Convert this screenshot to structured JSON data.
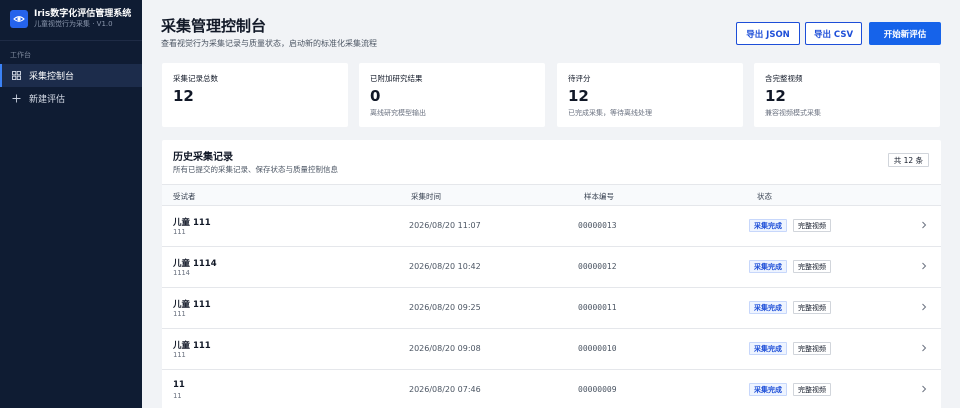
{
  "brand": {
    "title": "Iris数字化评估管理系统",
    "subtitle": "儿童视觉行为采集 · V1.0"
  },
  "sidebar": {
    "section": "工作台",
    "items": [
      {
        "label": "采集控制台",
        "icon": "grid-icon",
        "active": true
      },
      {
        "label": "新建评估",
        "icon": "plus-icon",
        "active": false
      }
    ]
  },
  "header": {
    "title": "采集管理控制台",
    "subtitle": "查看视觉行为采集记录与质量状态，启动新的标准化采集流程",
    "export_json": "导出 JSON",
    "export_csv": "导出 CSV",
    "start": "开始新评估"
  },
  "stats": [
    {
      "label": "采集记录总数",
      "value": "12",
      "note": ""
    },
    {
      "label": "已附加研究结果",
      "value": "0",
      "note": "离线研究模型输出"
    },
    {
      "label": "待评分",
      "value": "12",
      "note": "已完成采集，等待离线处理"
    },
    {
      "label": "含完整视频",
      "value": "12",
      "note": "兼容视频模式采集"
    }
  ],
  "records": {
    "title": "历史采集记录",
    "subtitle": "所有已提交的采集记录、保存状态与质量控制信息",
    "count": "共 12 条",
    "columns": {
      "subject": "受试者",
      "time": "采集时间",
      "sample": "样本编号",
      "status": "状态"
    },
    "rows": [
      {
        "name": "儿童 111",
        "id": "111",
        "time": "2026/08/20 11:07",
        "sample": "00000013",
        "status": "采集完成",
        "video": "完整视频"
      },
      {
        "name": "儿童 1114",
        "id": "1114",
        "time": "2026/08/20 10:42",
        "sample": "00000012",
        "status": "采集完成",
        "video": "完整视频"
      },
      {
        "name": "儿童 111",
        "id": "111",
        "time": "2026/08/20 09:25",
        "sample": "00000011",
        "status": "采集完成",
        "video": "完整视频"
      },
      {
        "name": "儿童 111",
        "id": "111",
        "time": "2026/08/20 09:08",
        "sample": "00000010",
        "status": "采集完成",
        "video": "完整视频"
      },
      {
        "name": "11",
        "id": "11",
        "time": "2026/08/20 07:46",
        "sample": "00000009",
        "status": "采集完成",
        "video": "完整视频"
      }
    ]
  },
  "colors": {
    "sidebar": "#0f1c33",
    "accent": "#1663ea",
    "background": "#f1f3f6"
  }
}
